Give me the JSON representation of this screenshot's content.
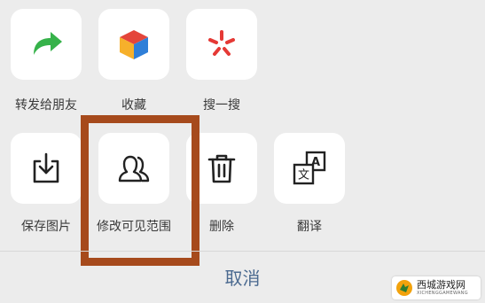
{
  "row1": [
    {
      "label": "转发给朋友",
      "icon": "forward-arrow-icon",
      "color": "#36b24a"
    },
    {
      "label": "收藏",
      "icon": "collect-cube-icon"
    },
    {
      "label": "搜一搜",
      "icon": "search-spark-icon",
      "color": "#e53935"
    }
  ],
  "row2": [
    {
      "label": "保存图片",
      "icon": "save-image-icon"
    },
    {
      "label": "修改可见范围",
      "icon": "visibility-people-icon"
    },
    {
      "label": "删除",
      "icon": "trash-icon"
    },
    {
      "label": "翻译",
      "icon": "translate-icon",
      "glyph_a": "A",
      "glyph_wen": "文"
    }
  ],
  "cancel_label": "取消",
  "highlight_color": "#a64a1c",
  "watermark": {
    "main": "西城游戏网",
    "sub": "XICHENGGAMEWANG"
  }
}
